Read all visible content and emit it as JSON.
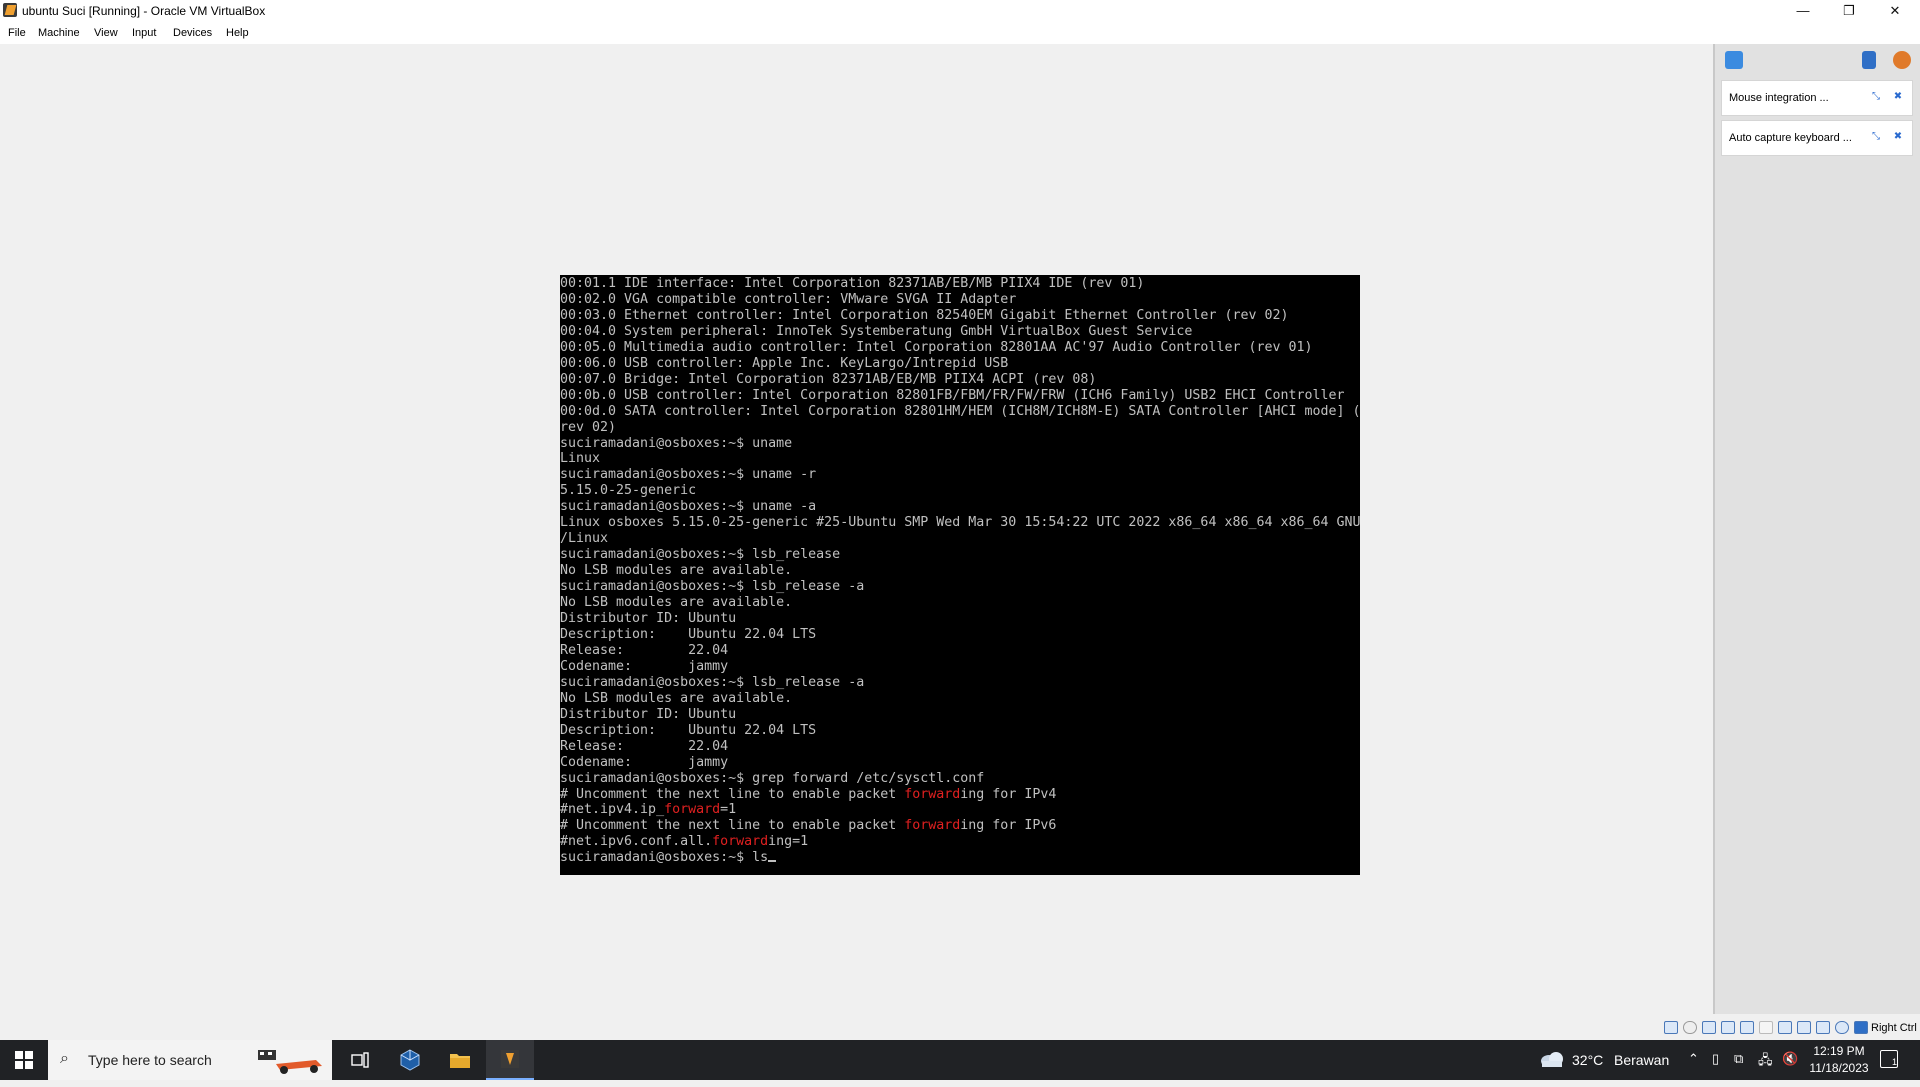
{
  "window": {
    "title": "ubuntu Suci [Running] - Oracle VM VirtualBox",
    "controls": {
      "minimize": "—",
      "maximize": "❐",
      "close": "✕"
    }
  },
  "menu": [
    "File",
    "Machine",
    "View",
    "Input",
    "Devices",
    "Help"
  ],
  "console": {
    "lines": [
      [
        {
          "t": "00:01.1 IDE interface: Intel Corporation 82371AB/EB/MB PIIX4 IDE (rev 01)"
        }
      ],
      [
        {
          "t": "00:02.0 VGA compatible controller: VMware SVGA II Adapter"
        }
      ],
      [
        {
          "t": "00:03.0 Ethernet controller: Intel Corporation 82540EM Gigabit Ethernet Controller (rev 02)"
        }
      ],
      [
        {
          "t": "00:04.0 System peripheral: InnoTek Systemberatung GmbH VirtualBox Guest Service"
        }
      ],
      [
        {
          "t": "00:05.0 Multimedia audio controller: Intel Corporation 82801AA AC'97 Audio Controller (rev 01)"
        }
      ],
      [
        {
          "t": "00:06.0 USB controller: Apple Inc. KeyLargo/Intrepid USB"
        }
      ],
      [
        {
          "t": "00:07.0 Bridge: Intel Corporation 82371AB/EB/MB PIIX4 ACPI (rev 08)"
        }
      ],
      [
        {
          "t": "00:0b.0 USB controller: Intel Corporation 82801FB/FBM/FR/FW/FRW (ICH6 Family) USB2 EHCI Controller"
        }
      ],
      [
        {
          "t": "00:0d.0 SATA controller: Intel Corporation 82801HM/HEM (ICH8M/ICH8M-E) SATA Controller [AHCI mode] ("
        }
      ],
      [
        {
          "t": "rev 02)"
        }
      ],
      [
        {
          "t": "suciramadani@osboxes:~$ uname"
        }
      ],
      [
        {
          "t": "Linux"
        }
      ],
      [
        {
          "t": "suciramadani@osboxes:~$ uname -r"
        }
      ],
      [
        {
          "t": "5.15.0-25-generic"
        }
      ],
      [
        {
          "t": "suciramadani@osboxes:~$ uname -a"
        }
      ],
      [
        {
          "t": "Linux osboxes 5.15.0-25-generic #25-Ubuntu SMP Wed Mar 30 15:54:22 UTC 2022 x86_64 x86_64 x86_64 GNU"
        }
      ],
      [
        {
          "t": "/Linux"
        }
      ],
      [
        {
          "t": "suciramadani@osboxes:~$ lsb_release"
        }
      ],
      [
        {
          "t": "No LSB modules are available."
        }
      ],
      [
        {
          "t": "suciramadani@osboxes:~$ lsb_release -a"
        }
      ],
      [
        {
          "t": "No LSB modules are available."
        }
      ],
      [
        {
          "t": "Distributor ID: Ubuntu"
        }
      ],
      [
        {
          "t": "Description:    Ubuntu 22.04 LTS"
        }
      ],
      [
        {
          "t": "Release:        22.04"
        }
      ],
      [
        {
          "t": "Codename:       jammy"
        }
      ],
      [
        {
          "t": "suciramadani@osboxes:~$ lsb_release -a"
        }
      ],
      [
        {
          "t": "No LSB modules are available."
        }
      ],
      [
        {
          "t": "Distributor ID: Ubuntu"
        }
      ],
      [
        {
          "t": "Description:    Ubuntu 22.04 LTS"
        }
      ],
      [
        {
          "t": "Release:        22.04"
        }
      ],
      [
        {
          "t": "Codename:       jammy"
        }
      ],
      [
        {
          "t": "suciramadani@osboxes:~$ grep forward /etc/sysctl.conf"
        }
      ],
      [
        {
          "t": "# Uncomment the next line to enable packet "
        },
        {
          "t": "forward",
          "hl": true
        },
        {
          "t": "ing for IPv4"
        }
      ],
      [
        {
          "t": "#net.ipv4.ip_"
        },
        {
          "t": "forward",
          "hl": true
        },
        {
          "t": "=1"
        }
      ],
      [
        {
          "t": "# Uncomment the next line to enable packet "
        },
        {
          "t": "forward",
          "hl": true
        },
        {
          "t": "ing for IPv6"
        }
      ],
      [
        {
          "t": "#net.ipv6.conf.all."
        },
        {
          "t": "forward",
          "hl": true
        },
        {
          "t": "ing=1"
        }
      ],
      [
        {
          "t": "suciramadani@osboxes:~$ ls"
        }
      ]
    ],
    "highlight_color": "#e02020",
    "text_color": "#c0c0c0",
    "background": "#000000"
  },
  "notifications": {
    "items": [
      {
        "text": "Mouse integration ..."
      },
      {
        "text": "Auto capture keyboard ..."
      }
    ]
  },
  "statusbar": {
    "host_key": "Right Ctrl"
  },
  "taskbar": {
    "search_placeholder": "Type here to search",
    "weather": {
      "temp": "32°C",
      "desc": "Berawan"
    },
    "clock": {
      "time": "12:19 PM",
      "date": "11/18/2023"
    },
    "notification_count": "1"
  }
}
